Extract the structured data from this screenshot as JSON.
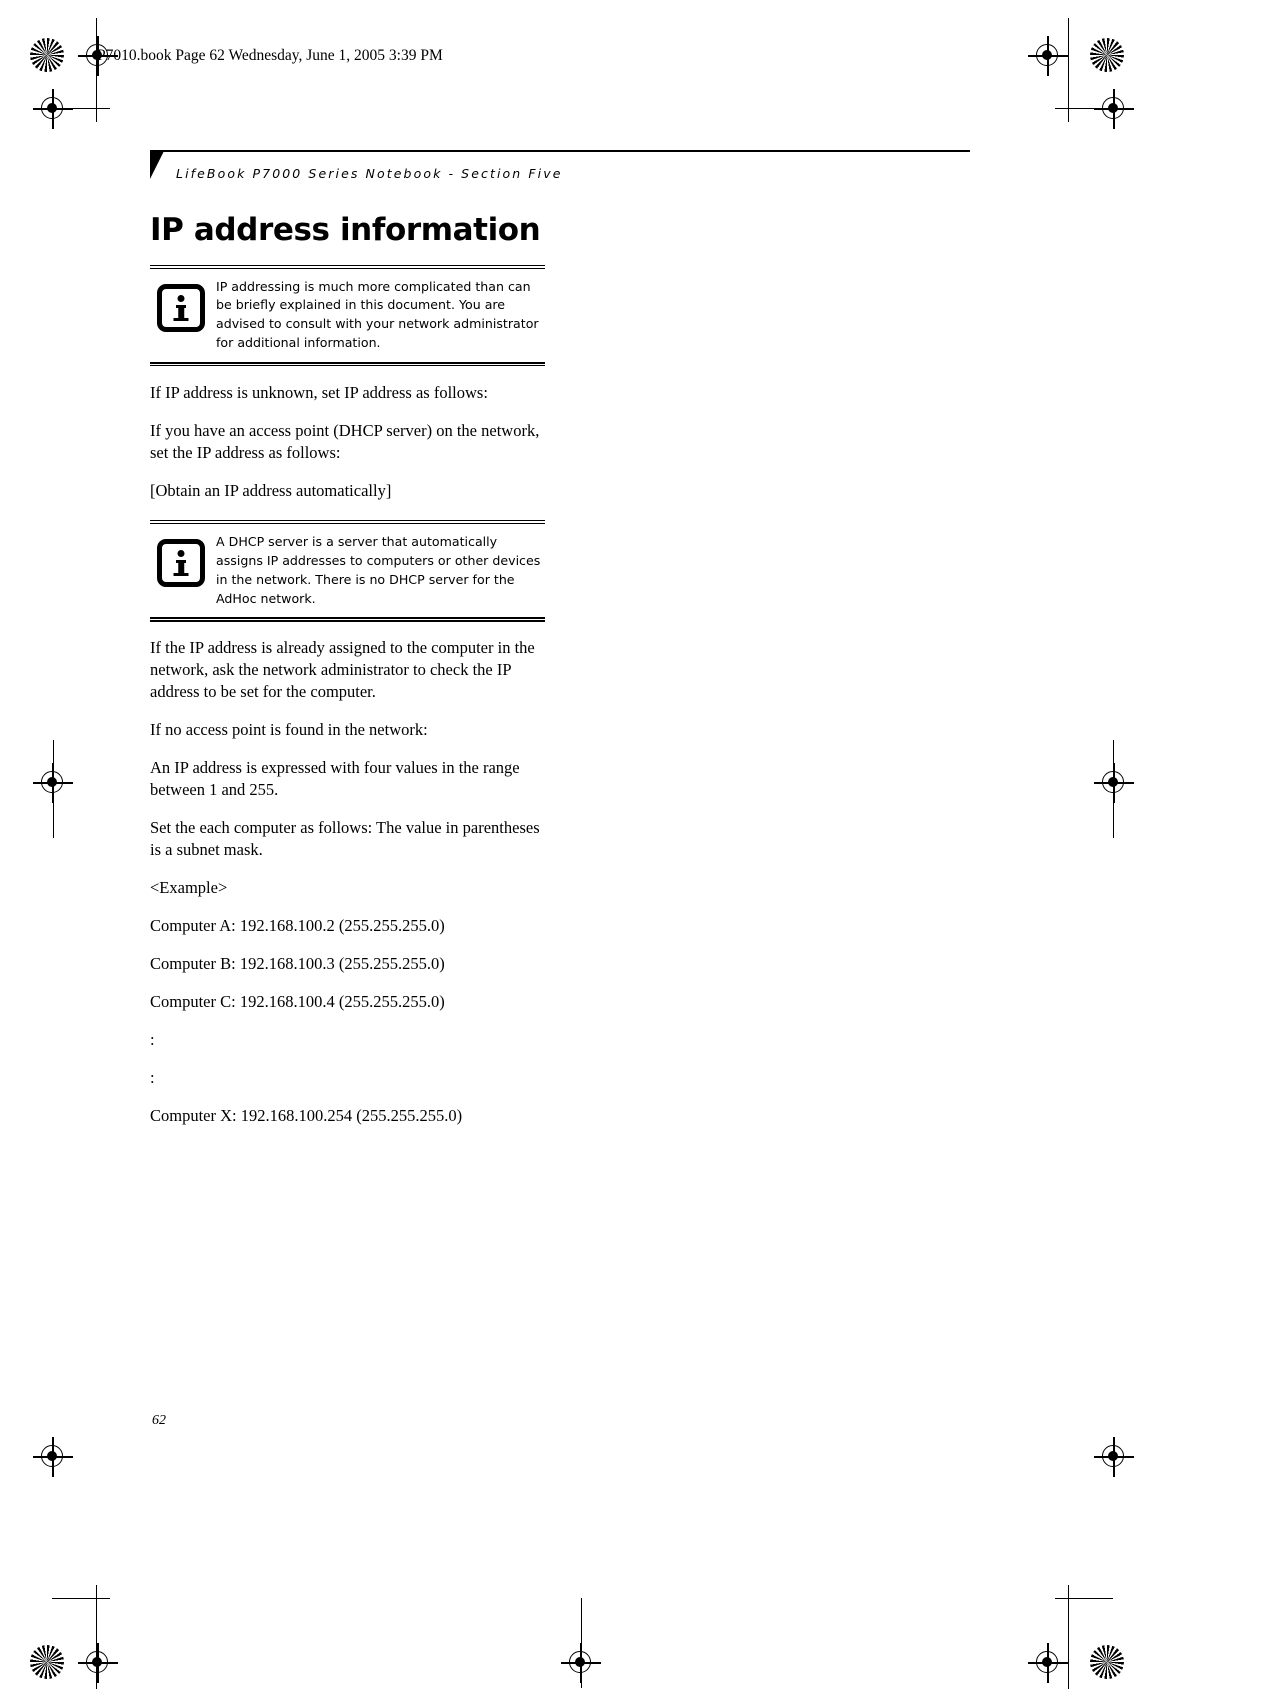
{
  "file_header": "P7010.book  Page 62  Wednesday, June 1, 2005  3:39 PM",
  "running_header": "LifeBook P7000 Series Notebook - Section Five",
  "section_title": "IP address information",
  "notes": [
    {
      "icon": "info-icon",
      "text": "IP addressing is much more complicated than can be briefly explained in this document. You are advised to consult with your network administrator for additional information."
    },
    {
      "icon": "info-icon",
      "text": "A DHCP server is a server that automatically assigns IP addresses to computers or other devices in the network. There is no DHCP server for the AdHoc network."
    }
  ],
  "paragraphs": {
    "p1": "If IP address is unknown, set IP address as follows:",
    "p2": "If you have an access point (DHCP server) on the network, set the IP address as follows:",
    "p3": "[Obtain an IP address automatically]",
    "p4": "If the IP address is already assigned to the computer in the network, ask the network administrator to check the IP address to be set for the computer.",
    "p5": "If no access point is found in the network:",
    "p6": "An IP address is expressed with four values in the range between 1 and 255.",
    "p7": "Set the each computer as follows: The value in parentheses is a subnet mask.",
    "p8": "<Example>",
    "computer_a": "Computer A: 192.168.100.2 (255.255.255.0)",
    "computer_b": "Computer B: 192.168.100.3 (255.255.255.0)",
    "computer_c": "Computer C: 192.168.100.4 (255.255.255.0)",
    "ellipsis_1": ":",
    "ellipsis_2": ":",
    "computer_x": "Computer X: 192.168.100.254 (255.255.255.0)"
  },
  "page_number": "62",
  "colors": {
    "text": "#000000",
    "background": "#ffffff"
  }
}
